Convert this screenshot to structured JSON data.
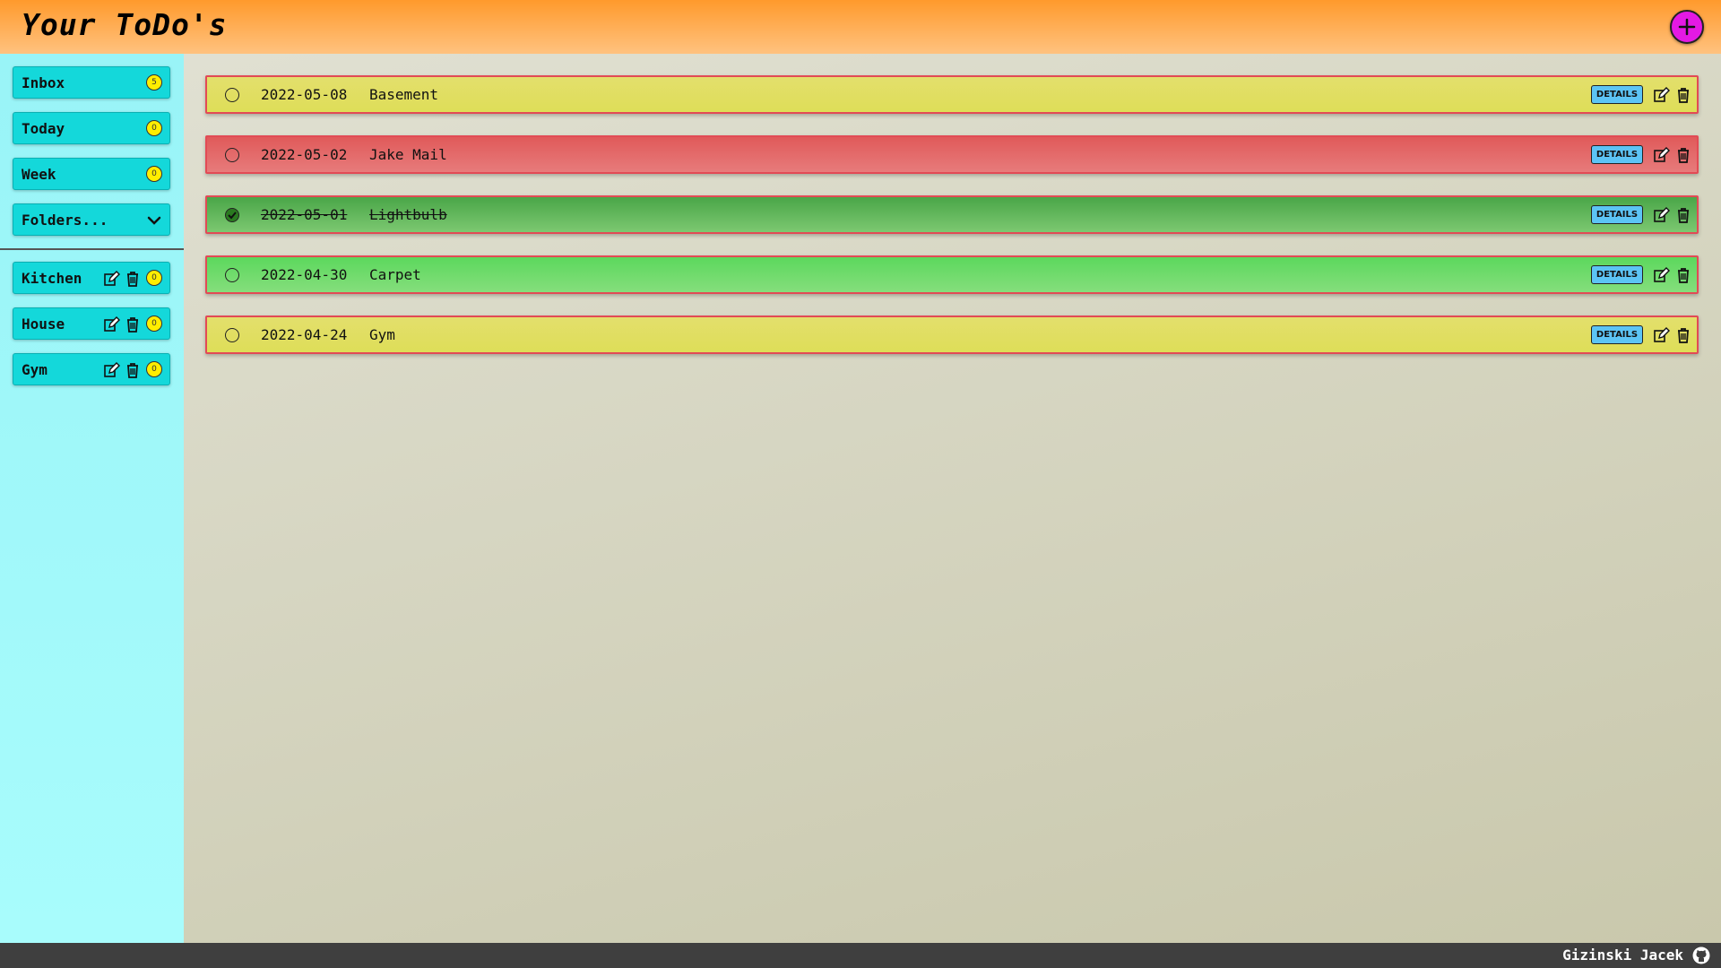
{
  "header": {
    "title": "Your ToDo's",
    "add_icon": "plus-circle-icon",
    "accent": "#e419e4"
  },
  "sidebar": {
    "nav": [
      {
        "label": "Inbox",
        "count": "5"
      },
      {
        "label": "Today",
        "count": "0"
      },
      {
        "label": "Week",
        "count": "0"
      }
    ],
    "folders_label": "Folders...",
    "folders": [
      {
        "label": "Kitchen",
        "count": "0"
      },
      {
        "label": "House",
        "count": "0"
      },
      {
        "label": "Gym",
        "count": "0"
      }
    ]
  },
  "todos": [
    {
      "date": "2022-05-08",
      "title": "Basement",
      "done": false,
      "color": "yellow"
    },
    {
      "date": "2022-05-02",
      "title": "Jake Mail",
      "done": false,
      "color": "red"
    },
    {
      "date": "2022-05-01",
      "title": "Lightbulb",
      "done": true,
      "color": "dark-green"
    },
    {
      "date": "2022-04-30",
      "title": "Carpet",
      "done": false,
      "color": "green"
    },
    {
      "date": "2022-04-24",
      "title": "Gym",
      "done": false,
      "color": "yellow"
    }
  ],
  "details_label": "DETAILS",
  "footer": {
    "name": "Gizinski Jacek",
    "icon": "github-icon"
  }
}
